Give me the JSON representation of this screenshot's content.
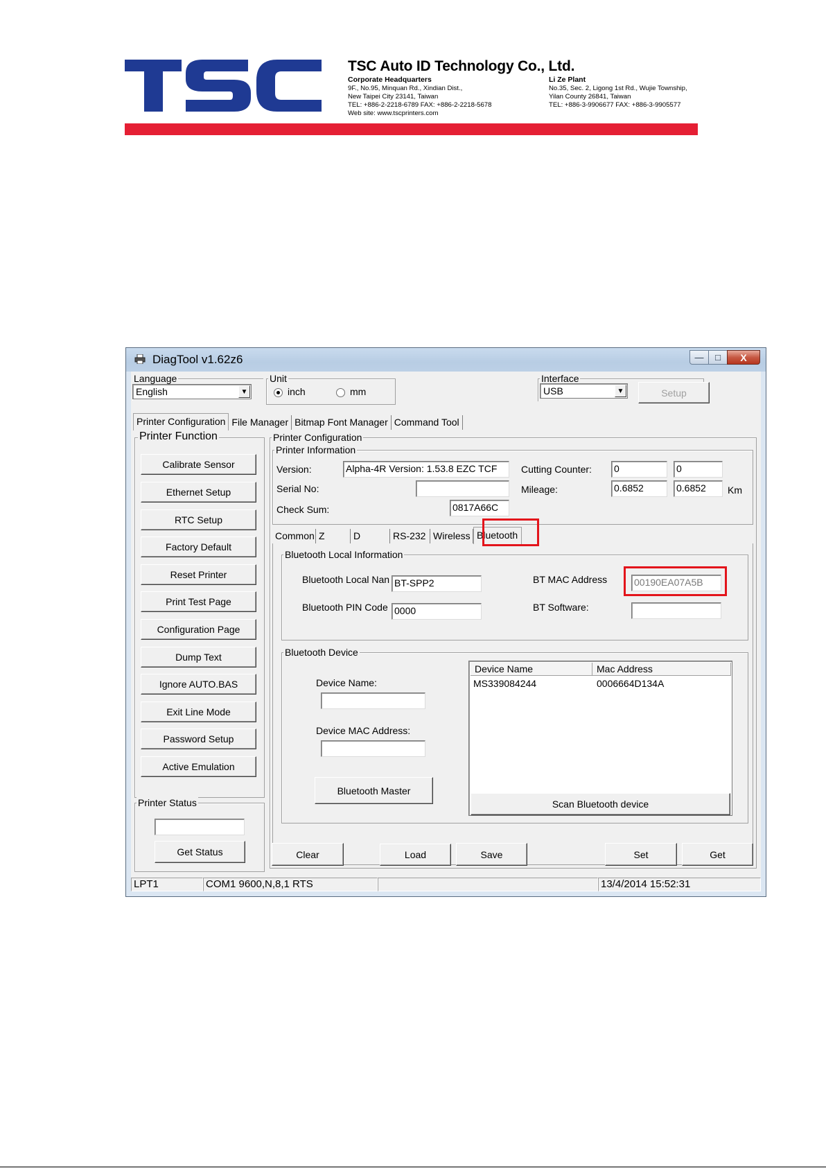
{
  "letterhead": {
    "logo_text": "TSC",
    "company": "TSC Auto ID Technology Co., Ltd.",
    "hq": {
      "heading": "Corporate Headquarters",
      "line1": "9F., No.95, Minquan Rd., Xindian Dist.,",
      "line2": "New Taipei City 23141, Taiwan",
      "line3": "TEL: +886-2-2218-6789    FAX: +886-2-2218-5678",
      "line4": "Web site: www.tscprinters.com"
    },
    "plant": {
      "heading": "Li Ze Plant",
      "line1": "No.35, Sec. 2, Ligong 1st Rd., Wujie Township,",
      "line2": "Yilan County 26841, Taiwan",
      "line3": "TEL: +886-3-9906677    FAX: +886-3-9905577"
    },
    "colors": {
      "logo_blue": "#1f3a93",
      "bar_red": "#e51f34"
    }
  },
  "window": {
    "title": "DiagTool v1.62z6",
    "controls": {
      "minimize": "—",
      "maximize": "□",
      "close": "X"
    }
  },
  "language": {
    "label": "Language",
    "value": "English"
  },
  "unit": {
    "label": "Unit",
    "inch": "inch",
    "mm": "mm",
    "selected": "inch"
  },
  "interface": {
    "label": "Interface",
    "value": "USB",
    "setup_button": "Setup"
  },
  "main_tabs": [
    "Printer Configuration",
    "File Manager",
    "Bitmap Font Manager",
    "Command Tool"
  ],
  "printer_function": {
    "title": "Printer Function",
    "buttons": [
      "Calibrate Sensor",
      "Ethernet Setup",
      "RTC Setup",
      "Factory Default",
      "Reset Printer",
      "Print Test Page",
      "Configuration Page",
      "Dump Text",
      "Ignore AUTO.BAS",
      "Exit Line Mode",
      "Password Setup",
      "Active Emulation"
    ]
  },
  "printer_status": {
    "title": "Printer Status",
    "value": "",
    "button": "Get Status"
  },
  "printer_configuration": {
    "title": "Printer Configuration",
    "info_title": "Printer Information",
    "version_label": "Version:",
    "version_value": "Alpha-4R Version: 1.53.8 EZC TCF",
    "serial_label": "Serial No:",
    "serial_value": "",
    "checksum_label": "Check Sum:",
    "checksum_value": "0817A66C",
    "cutting_label": "Cutting Counter:",
    "cutting_value1": "0",
    "cutting_value2": "0",
    "mileage_label": "Mileage:",
    "mileage_value1": "0.6852",
    "mileage_value2": "0.6852",
    "mileage_unit": "Km"
  },
  "sub_tabs": [
    "Common",
    "Z",
    "D",
    "RS-232",
    "Wireless",
    "Bluetooth"
  ],
  "bluetooth_local": {
    "title": "Bluetooth Local Information",
    "local_name_label": "Bluetooth Local Nan",
    "local_name_value": "BT-SPP2",
    "pin_label": "Bluetooth PIN Code",
    "pin_value": "0000",
    "mac_label": "BT MAC Address",
    "mac_value": "00190EA07A5B",
    "software_label": "BT Software:",
    "software_value": ""
  },
  "bluetooth_device": {
    "title": "Bluetooth Device",
    "name_label": "Device Name:",
    "name_value": "",
    "mac_label": "Device MAC Address:",
    "mac_value": "",
    "master_button": "Bluetooth Master",
    "list_headers": [
      "Device Name",
      "Mac Address"
    ],
    "list_rows": [
      {
        "name": "MS339084244",
        "mac": "0006664D134A"
      }
    ],
    "scan_button": "Scan Bluetooth device"
  },
  "action_buttons": {
    "clear": "Clear",
    "load": "Load",
    "save": "Save",
    "set": "Set",
    "get": "Get"
  },
  "status_bar": {
    "port": "LPT1",
    "com": "COM1 9600,N,8,1 RTS",
    "middle": "",
    "datetime": "13/4/2014 15:52:31"
  },
  "highlight_color": "#e3141b"
}
